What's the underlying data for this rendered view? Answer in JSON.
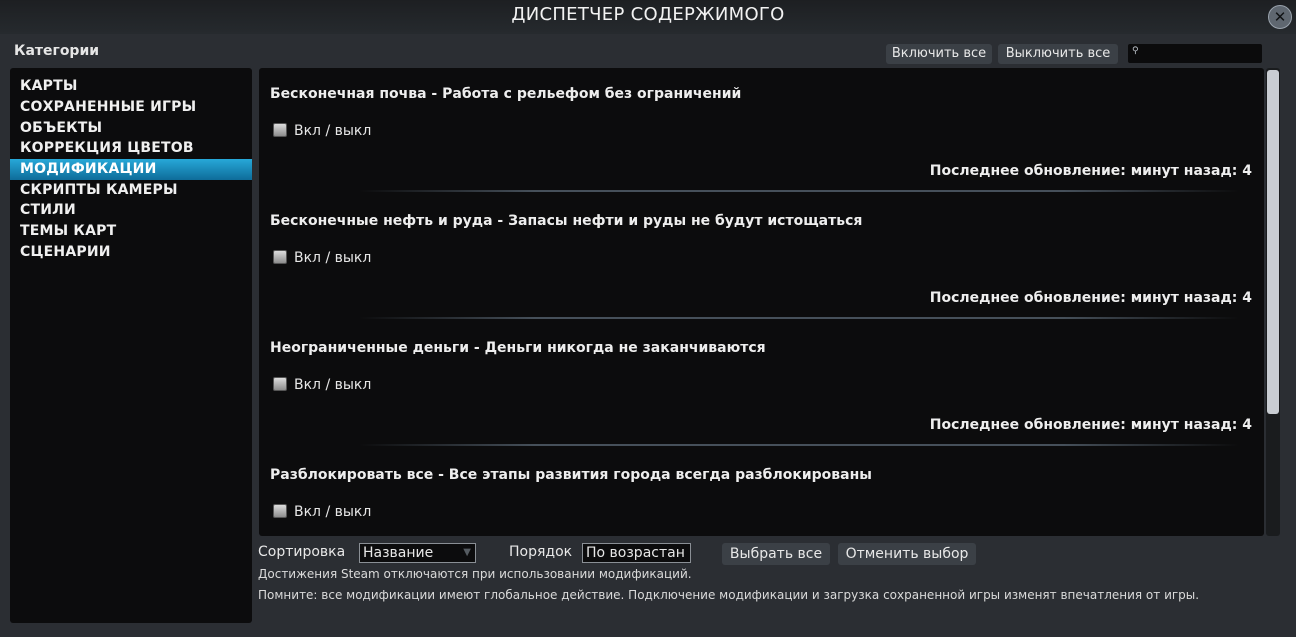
{
  "window": {
    "title": "ДИСПЕТЧЕР СОДЕРЖИМОГО",
    "close_glyph": "✕"
  },
  "categories": {
    "heading": "Категории",
    "items": [
      {
        "label": "КАРТЫ",
        "selected": false
      },
      {
        "label": "СОХРАНЕННЫЕ ИГРЫ",
        "selected": false
      },
      {
        "label": "ОБЪЕКТЫ",
        "selected": false
      },
      {
        "label": "КОРРЕКЦИЯ ЦВЕТОВ",
        "selected": false
      },
      {
        "label": "МОДИФИКАЦИИ",
        "selected": true
      },
      {
        "label": "СКРИПТЫ КАМЕРЫ",
        "selected": false
      },
      {
        "label": "СТИЛИ",
        "selected": false
      },
      {
        "label": "ТЕМЫ КАРТ",
        "selected": false
      },
      {
        "label": "СЦЕНАРИИ",
        "selected": false
      }
    ]
  },
  "toolbar": {
    "enable_all": "Включить все",
    "disable_all": "Выключить все",
    "search_value": "",
    "search_icon": "search-icon"
  },
  "mods": [
    {
      "title": "Бесконечная почва - Работа с рельефом без ограничений",
      "toggle_label": "Вкл / выкл",
      "enabled": false,
      "updated": "Последнее обновление: минут назад: 4"
    },
    {
      "title": "Бесконечные нефть и руда - Запасы нефти и руды не будут истощаться",
      "toggle_label": "Вкл / выкл",
      "enabled": false,
      "updated": "Последнее обновление: минут назад: 4"
    },
    {
      "title": "Неограниченные деньги - Деньги никогда не заканчиваются",
      "toggle_label": "Вкл / выкл",
      "enabled": false,
      "updated": "Последнее обновление: минут назад: 4"
    },
    {
      "title": "Разблокировать все - Все этапы развития города всегда разблокированы",
      "toggle_label": "Вкл / выкл",
      "enabled": false,
      "updated": ""
    }
  ],
  "footer": {
    "sort_label": "Сортировка",
    "sort_value": "Название",
    "order_label": "Порядок",
    "order_value": "По возрастан",
    "select_all": "Выбрать все",
    "deselect": "Отменить выбор",
    "note_1": "Достижения Steam отключаются при использовании модификаций.",
    "note_2": "Помните: все модификации имеют глобальное действие. Подключение модификации и загрузка сохраненной игры изменят впечатления от игры."
  },
  "colors": {
    "accent": "#1f95c8",
    "panel": "#0c0c0d",
    "background": "#2b2e33"
  }
}
